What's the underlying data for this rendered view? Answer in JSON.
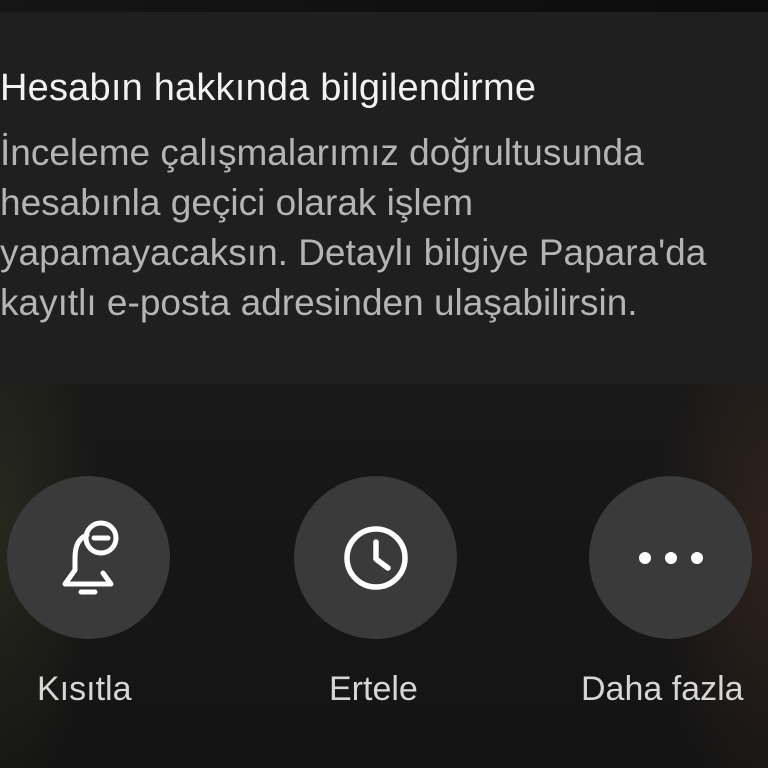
{
  "notification": {
    "title": "Hesabın hakkında bilgilendirme",
    "body_lines": [
      "İnceleme çalışmalarımız doğrultusunda",
      "hesabınla geçici olarak işlem",
      "yapamayacaksın. Detaylı bilgiye Papara'da",
      "kayıtlı e-posta adresinden ulaşabilirsin."
    ]
  },
  "actions": [
    {
      "label": "Kısıtla",
      "icon": "bell-minus-icon"
    },
    {
      "label": "Ertele",
      "icon": "clock-icon"
    },
    {
      "label": "Daha fazla",
      "icon": "more-horizontal-icon"
    }
  ],
  "colors": {
    "background": "#181818",
    "card": "#1f1f1f",
    "title_text": "#f2f2f2",
    "body_text": "#b4b4b4",
    "action_circle": "#3a3a3a",
    "icon": "#ffffff"
  }
}
